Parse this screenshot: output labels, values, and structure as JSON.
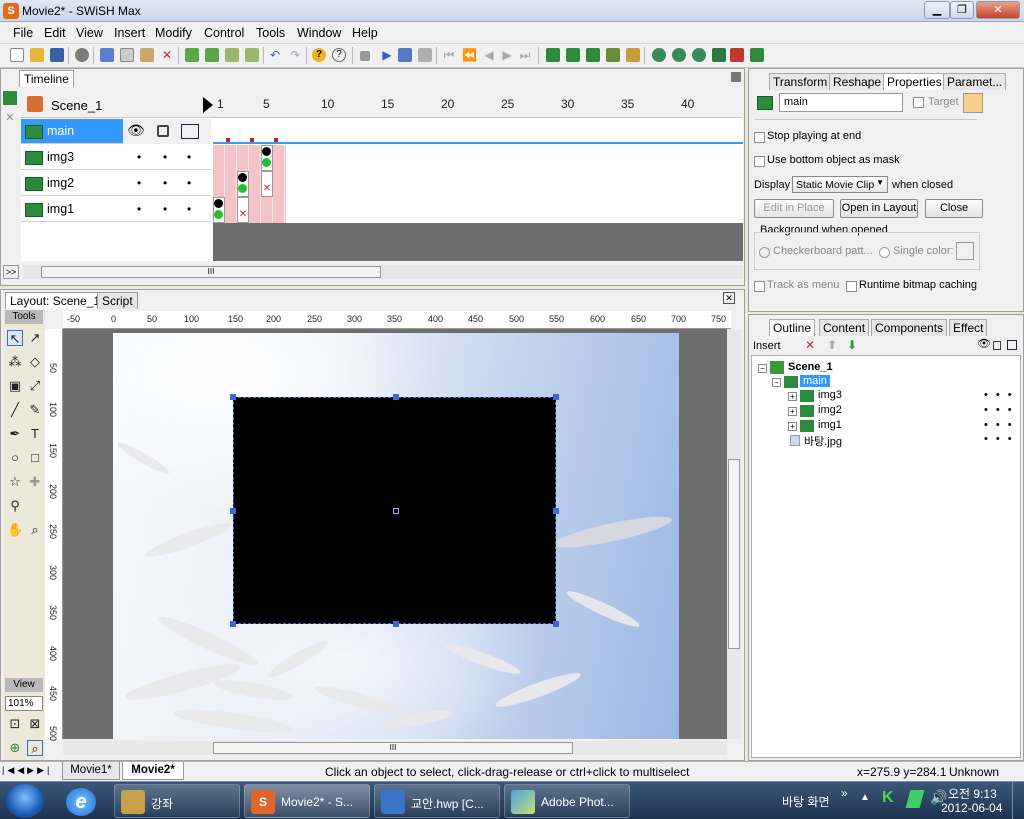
{
  "window": {
    "title": "Movie2* - SWiSH Max",
    "app_letter": "S"
  },
  "menu": [
    "File",
    "Edit",
    "View",
    "Insert",
    "Modify",
    "Control",
    "Tools",
    "Window",
    "Help"
  ],
  "timeline": {
    "tab": "Timeline",
    "scene": "Scene_1",
    "frame_numbers": [
      "1",
      "5",
      "10",
      "15",
      "20",
      "25",
      "30",
      "35",
      "40"
    ],
    "layers": [
      {
        "name": "main",
        "selected": true
      },
      {
        "name": "img3",
        "selected": false
      },
      {
        "name": "img2",
        "selected": false
      },
      {
        "name": "img1",
        "selected": false
      }
    ],
    "expand_label": ">>",
    "scroll_label": "III"
  },
  "layout": {
    "tab_active": "Layout: Scene_1",
    "tab_script": "Script",
    "tools_label": "Tools",
    "view_label": "View",
    "zoom": "101%",
    "ruler_top": [
      "-50",
      "0",
      "50",
      "100",
      "150",
      "200",
      "250",
      "300",
      "350",
      "400",
      "450",
      "500",
      "550",
      "600",
      "650",
      "700",
      "750"
    ],
    "ruler_left": [
      "50",
      "100",
      "150",
      "200",
      "250",
      "300",
      "350",
      "400",
      "450",
      "500"
    ],
    "hscroll_label": "III"
  },
  "properties": {
    "tabs": [
      "Transform",
      "Reshape",
      "Properties",
      "Paramet..."
    ],
    "active_tab": "Properties",
    "name_value": "main",
    "target_label": "Target",
    "stop_playing": "Stop playing at end",
    "use_bottom_mask": "Use bottom object as mask",
    "display_label": "Display",
    "display_value": "Static Movie Clip",
    "when_closed": "when closed",
    "edit_in_place": "Edit in Place",
    "open_in_layout": "Open in Layout",
    "close": "Close",
    "bg_when_opened": "Background when opened",
    "checkerboard": "Checkerboard patt...",
    "single_color": "Single color:",
    "track_as_menu": "Track as menu",
    "runtime_bitmap": "Runtime bitmap caching"
  },
  "outline": {
    "tabs": [
      "Outline",
      "Content",
      "Components",
      "Effect"
    ],
    "active_tab": "Outline",
    "insert_label": "Insert",
    "tree": [
      {
        "label": "Scene_1"
      },
      {
        "label": "main"
      },
      {
        "label": "img3"
      },
      {
        "label": "img2"
      },
      {
        "label": "img1"
      },
      {
        "label": "바탕.jpg"
      }
    ]
  },
  "statusbar": {
    "tabs": [
      "Movie1*",
      "Movie2*"
    ],
    "message": "Click an object to select, click-drag-release or ctrl+click to multiselect",
    "coords": "x=275.9 y=284.1",
    "size": "Unknown Size"
  },
  "taskbar": {
    "items": [
      "강좌",
      "Movie2* - S...",
      "교안.hwp [C...",
      "Adobe Phot..."
    ],
    "desktop_label": "바탕 화면",
    "desktop_arrow": "»",
    "time": "오전 9:13",
    "date": "2012-06-04"
  },
  "colors": {
    "accent": "#3f67d8",
    "selected_layer": "#3399ff",
    "frame_pink": "#f3c3c7"
  }
}
